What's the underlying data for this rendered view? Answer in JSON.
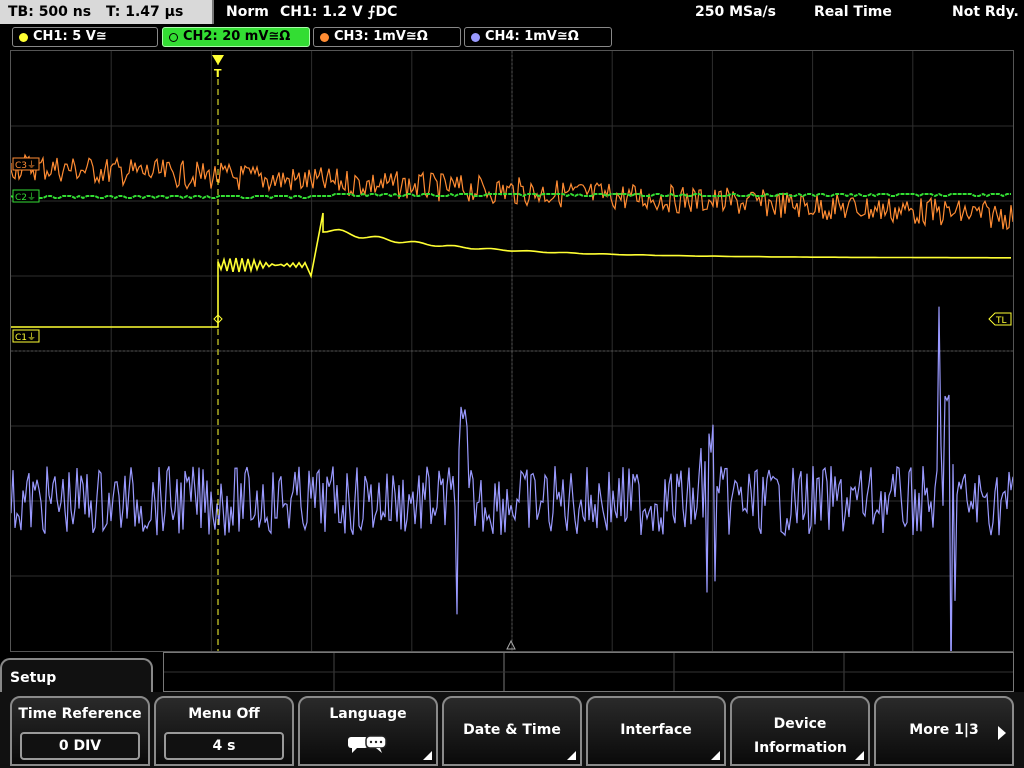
{
  "topbar": {
    "timebase": "TB: 500 ns",
    "trigger_time": "T: 1.47 µs",
    "mode": "Norm",
    "trigger": "CH1: 1.2 V ⨍DC",
    "sample_rate": "250 MSa/s",
    "acq_mode": "Real Time",
    "status": "Not Rdy."
  },
  "channels": [
    {
      "label": "CH1: 5 V≅",
      "color": "#ffff33"
    },
    {
      "label": "CH2: 20 mV≅Ω",
      "color": "#33dd33",
      "active": true
    },
    {
      "label": "CH3: 1mV≅Ω",
      "color": "#ff8c33"
    },
    {
      "label": "CH4: 1mV≅Ω",
      "color": "#9a9aff"
    }
  ],
  "markers": {
    "c3": "C3⏚",
    "c2": "C2⏚",
    "c1": "C1⏚",
    "tl": "TL",
    "trigger": "T"
  },
  "menu": {
    "section": "Setup",
    "buttons": [
      {
        "title": "Time Reference",
        "value": "0 DIV"
      },
      {
        "title": "Menu Off",
        "value": "4 s"
      },
      {
        "title": "Language",
        "icon": "speech-bubbles-icon"
      },
      {
        "title": "Date & Time"
      },
      {
        "title": "Interface"
      },
      {
        "title": "Device Information"
      },
      {
        "title": "More 1|3"
      }
    ]
  },
  "colors": {
    "ch1": "#ffff33",
    "ch2": "#33dd33",
    "ch3": "#ff8c33",
    "ch4": "#9a9aff",
    "grid": "#3a3a3a"
  }
}
